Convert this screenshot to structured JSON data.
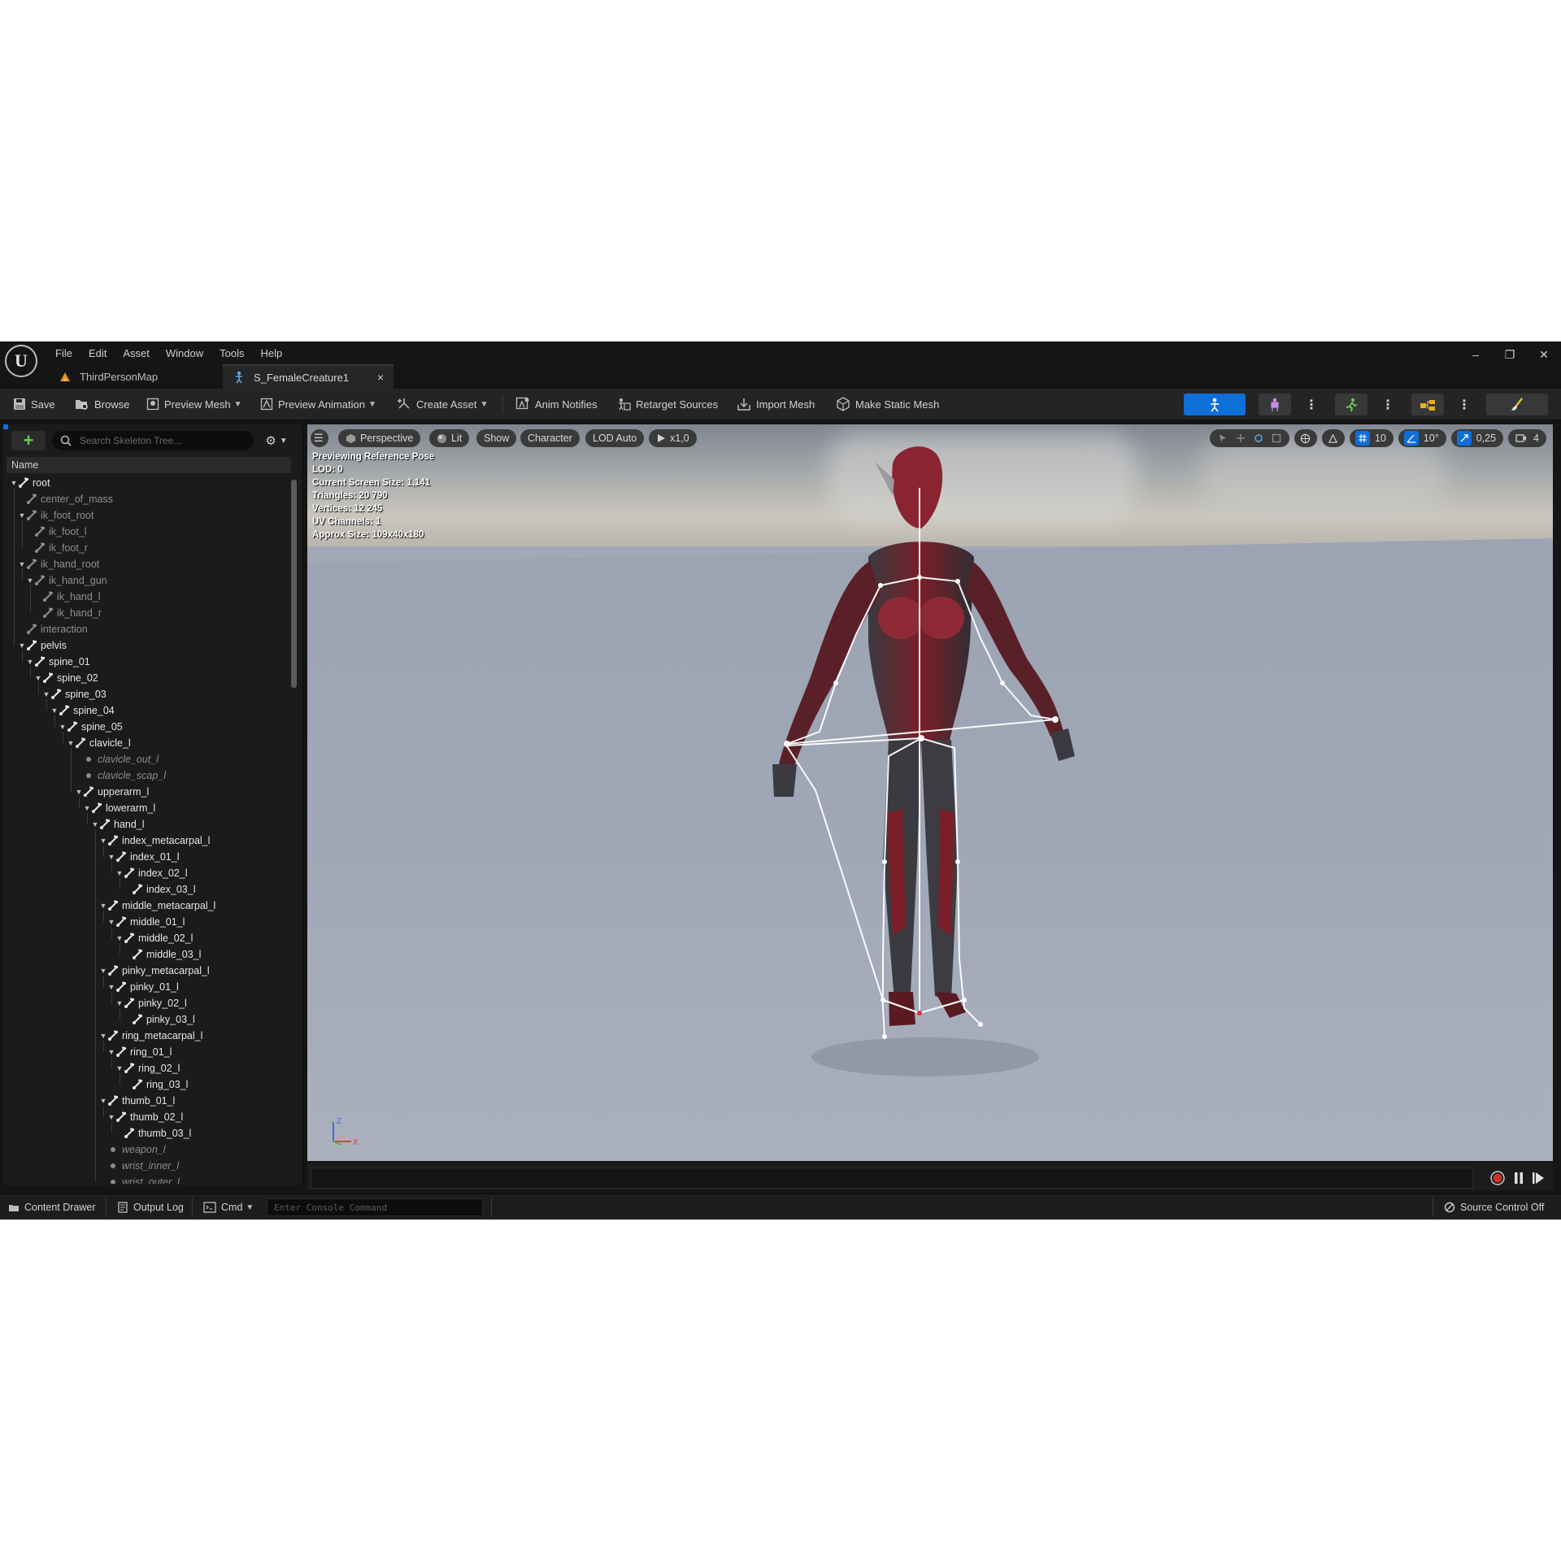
{
  "menu": [
    "File",
    "Edit",
    "Asset",
    "Window",
    "Tools",
    "Help"
  ],
  "tabs": [
    {
      "label": "ThirdPersonMap",
      "active": false
    },
    {
      "label": "S_FemaleCreature1",
      "active": true,
      "close": "×"
    }
  ],
  "window_controls": {
    "minimize": "–",
    "restore": "❐",
    "close": "✕"
  },
  "toolbar": {
    "save": "Save",
    "browse": "Browse",
    "preview_mesh": "Preview Mesh",
    "preview_animation": "Preview Animation",
    "create_asset": "Create Asset",
    "anim_notifies": "Anim Notifies",
    "retarget_sources": "Retarget Sources",
    "import_mesh": "Import Mesh",
    "make_static_mesh": "Make Static Mesh"
  },
  "skeleton_tree": {
    "search_placeholder": "Search Skeleton Tree...",
    "column_name": "Name",
    "rows": [
      {
        "label": "root",
        "depth": 0,
        "kind": "bone",
        "expanded": true
      },
      {
        "label": "center_of_mass",
        "depth": 1,
        "kind": "dim"
      },
      {
        "label": "ik_foot_root",
        "depth": 1,
        "kind": "dim",
        "expanded": true
      },
      {
        "label": "ik_foot_l",
        "depth": 2,
        "kind": "dim"
      },
      {
        "label": "ik_foot_r",
        "depth": 2,
        "kind": "dim"
      },
      {
        "label": "ik_hand_root",
        "depth": 1,
        "kind": "dim",
        "expanded": true
      },
      {
        "label": "ik_hand_gun",
        "depth": 2,
        "kind": "dim",
        "expanded": true
      },
      {
        "label": "ik_hand_l",
        "depth": 3,
        "kind": "dim"
      },
      {
        "label": "ik_hand_r",
        "depth": 3,
        "kind": "dim"
      },
      {
        "label": "interaction",
        "depth": 1,
        "kind": "dim"
      },
      {
        "label": "pelvis",
        "depth": 1,
        "kind": "bone",
        "expanded": true
      },
      {
        "label": "spine_01",
        "depth": 2,
        "kind": "bone",
        "expanded": true
      },
      {
        "label": "spine_02",
        "depth": 3,
        "kind": "bone",
        "expanded": true
      },
      {
        "label": "spine_03",
        "depth": 4,
        "kind": "bone",
        "expanded": true
      },
      {
        "label": "spine_04",
        "depth": 5,
        "kind": "bone",
        "expanded": true
      },
      {
        "label": "spine_05",
        "depth": 6,
        "kind": "bone",
        "expanded": true
      },
      {
        "label": "clavicle_l",
        "depth": 7,
        "kind": "bone",
        "expanded": true
      },
      {
        "label": "clavicle_out_l",
        "depth": 8,
        "kind": "socket"
      },
      {
        "label": "clavicle_scap_l",
        "depth": 8,
        "kind": "socket"
      },
      {
        "label": "upperarm_l",
        "depth": 8,
        "kind": "bone",
        "expanded": true
      },
      {
        "label": "lowerarm_l",
        "depth": 9,
        "kind": "bone",
        "expanded": true
      },
      {
        "label": "hand_l",
        "depth": 10,
        "kind": "bone",
        "expanded": true
      },
      {
        "label": "index_metacarpal_l",
        "depth": 11,
        "kind": "bone",
        "expanded": true
      },
      {
        "label": "index_01_l",
        "depth": 12,
        "kind": "bone",
        "expanded": true
      },
      {
        "label": "index_02_l",
        "depth": 13,
        "kind": "bone",
        "expanded": true
      },
      {
        "label": "index_03_l",
        "depth": 14,
        "kind": "bone"
      },
      {
        "label": "middle_metacarpal_l",
        "depth": 11,
        "kind": "bone",
        "expanded": true
      },
      {
        "label": "middle_01_l",
        "depth": 12,
        "kind": "bone",
        "expanded": true
      },
      {
        "label": "middle_02_l",
        "depth": 13,
        "kind": "bone",
        "expanded": true
      },
      {
        "label": "middle_03_l",
        "depth": 14,
        "kind": "bone"
      },
      {
        "label": "pinky_metacarpal_l",
        "depth": 11,
        "kind": "bone",
        "expanded": true
      },
      {
        "label": "pinky_01_l",
        "depth": 12,
        "kind": "bone",
        "expanded": true
      },
      {
        "label": "pinky_02_l",
        "depth": 13,
        "kind": "bone",
        "expanded": true
      },
      {
        "label": "pinky_03_l",
        "depth": 14,
        "kind": "bone"
      },
      {
        "label": "ring_metacarpal_l",
        "depth": 11,
        "kind": "bone",
        "expanded": true
      },
      {
        "label": "ring_01_l",
        "depth": 12,
        "kind": "bone",
        "expanded": true
      },
      {
        "label": "ring_02_l",
        "depth": 13,
        "kind": "bone",
        "expanded": true
      },
      {
        "label": "ring_03_l",
        "depth": 14,
        "kind": "bone"
      },
      {
        "label": "thumb_01_l",
        "depth": 11,
        "kind": "bone",
        "expanded": true
      },
      {
        "label": "thumb_02_l",
        "depth": 12,
        "kind": "bone",
        "expanded": true
      },
      {
        "label": "thumb_03_l",
        "depth": 13,
        "kind": "bone"
      },
      {
        "label": "weapon_l",
        "depth": 11,
        "kind": "socket"
      },
      {
        "label": "wrist_inner_l",
        "depth": 11,
        "kind": "socket"
      },
      {
        "label": "wrist_outer_l",
        "depth": 11,
        "kind": "socket"
      }
    ]
  },
  "viewport": {
    "perspective": "Perspective",
    "lit": "Lit",
    "show": "Show",
    "character": "Character",
    "lod": "LOD Auto",
    "play_rate": "x1,0",
    "grid_snap": "10",
    "rotation_snap": "10°",
    "scale_snap": "0,25",
    "camera_speed": "4",
    "stats": [
      "Previewing Reference Pose",
      "LOD: 0",
      "Current Screen Size: 1,141",
      "Triangles: 20 790",
      "Vertices: 12 245",
      "UV Channels: 1",
      "Approx Size: 109x40x180"
    ],
    "axis_z": "Z",
    "axis_x": "X"
  },
  "statusbar": {
    "content_drawer": "Content Drawer",
    "output_log": "Output Log",
    "cmd": "Cmd",
    "console_placeholder": "Enter Console Command",
    "source_control": "Source Control Off"
  },
  "colors": {
    "accent_blue": "#0e6fd8",
    "add_green": "#5fd04a",
    "record_red": "#c8342c",
    "suit_red": "#7a1e28"
  }
}
